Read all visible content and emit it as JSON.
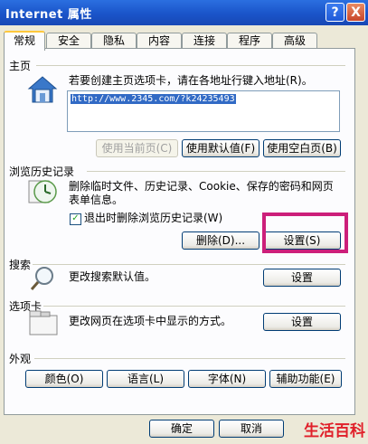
{
  "window": {
    "title": "Internet 属性",
    "help_label": "?",
    "close_label": "X"
  },
  "tabs": [
    {
      "label": "常规"
    },
    {
      "label": "安全"
    },
    {
      "label": "隐私"
    },
    {
      "label": "内容"
    },
    {
      "label": "连接"
    },
    {
      "label": "程序"
    },
    {
      "label": "高级"
    }
  ],
  "home": {
    "title": "主页",
    "description": "若要创建主页选项卡，请在各地址行键入地址(R)。",
    "url_value": "http://www.2345.com/?k24235493",
    "use_current_label": "使用当前页(C)",
    "use_default_label": "使用默认值(F)",
    "use_blank_label": "使用空白页(B)"
  },
  "history": {
    "title": "浏览历史记录",
    "description_line1": "删除临时文件、历史记录、Cookie、保存的密码和网页",
    "description_line2": "表单信息。",
    "checkbox_label": "退出时删除浏览历史记录(W)",
    "checkbox_checked": true,
    "delete_label": "删除(D)...",
    "settings_label": "设置(S)"
  },
  "search": {
    "title": "搜索",
    "description": "更改搜索默认值。",
    "settings_label": "设置"
  },
  "tabs_section": {
    "title": "选项卡",
    "description": "更改网页在选项卡中显示的方式。",
    "settings_label": "设置"
  },
  "appearance": {
    "title": "外观",
    "colors_label": "颜色(O)",
    "languages_label": "语言(L)",
    "fonts_label": "字体(N)",
    "accessibility_label": "辅助功能(E)"
  },
  "footer": {
    "ok_label": "确定",
    "cancel_label": "取消"
  },
  "watermark": {
    "text": "生活百科"
  }
}
